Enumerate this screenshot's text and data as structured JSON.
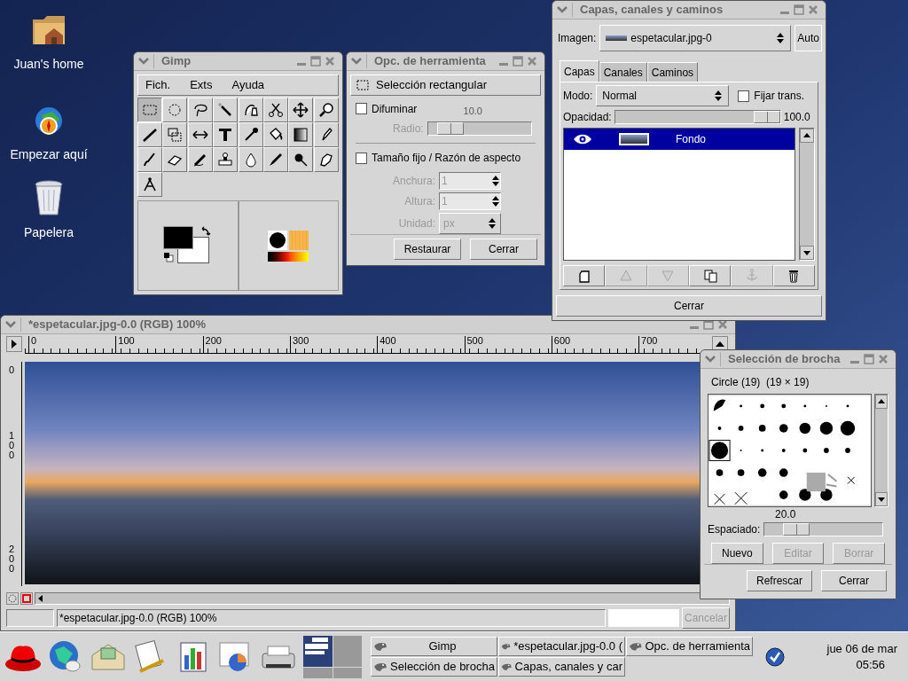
{
  "desktop_icons": [
    {
      "label": "Juan's home"
    },
    {
      "label": "Empezar aquí"
    },
    {
      "label": "Papelera"
    }
  ],
  "toolbox": {
    "title": "Gimp",
    "menu": [
      "Fich.",
      "Exts",
      "Ayuda"
    ],
    "tools": [
      {
        "selected": true
      },
      {
        "selected": false
      },
      {
        "selected": false
      },
      {
        "selected": false
      },
      {
        "selected": false
      },
      {
        "selected": false
      },
      {
        "selected": false
      },
      {
        "selected": false
      },
      {
        "selected": false
      },
      {
        "selected": false
      },
      {
        "selected": false
      },
      {
        "selected": false
      },
      {
        "selected": false
      },
      {
        "selected": false
      },
      {
        "selected": false
      },
      {
        "selected": false
      },
      {
        "selected": false
      },
      {
        "selected": false
      },
      {
        "selected": false
      },
      {
        "selected": false
      },
      {
        "selected": false
      },
      {
        "selected": false
      },
      {
        "selected": false
      },
      {
        "selected": false
      },
      {
        "selected": false
      }
    ]
  },
  "tool_options": {
    "title": "Opc. de herramienta",
    "tool_name": "Selección rectangular",
    "feather": {
      "label": "Difuminar",
      "checked": false
    },
    "radius": {
      "label": "Radio:",
      "value": "10.0",
      "level": 0.12,
      "disabled": true
    },
    "fixed_size": {
      "label": "Tamaño fijo / Razón de aspecto",
      "checked": false
    },
    "fields": [
      {
        "label": "Anchura:",
        "value": "1",
        "disabled": true
      },
      {
        "label": "Altura:",
        "value": "1",
        "disabled": true
      }
    ],
    "unit": {
      "label": "Unidad:",
      "value": "px",
      "disabled": true
    },
    "buttons": [
      "Restaurar",
      "Cerrar"
    ]
  },
  "layers_dialog": {
    "title": "Capas, canales y caminos",
    "image_label": "Imagen:",
    "image_value": "espetacular.jpg-0",
    "auto_button": "Auto",
    "tabs": [
      {
        "label": "Capas",
        "selected": true
      },
      {
        "label": "Canales",
        "selected": false
      },
      {
        "label": "Caminos",
        "selected": false
      }
    ],
    "mode_label": "Modo:",
    "mode_value": "Normal",
    "keep_trans": {
      "label": "Fijar trans.",
      "checked": false
    },
    "opacity": {
      "label": "Opacidad:",
      "level": 1.0,
      "reading": "100.0"
    },
    "layers": [
      {
        "name": "Fondo",
        "selected": true,
        "visible": true
      }
    ],
    "layer_buttons": [
      {
        "disabled": false
      },
      {
        "disabled": true
      },
      {
        "disabled": true
      },
      {
        "disabled": false
      },
      {
        "disabled": true
      },
      {
        "disabled": false
      }
    ],
    "close_button": "Cerrar"
  },
  "image_window": {
    "title": "*espetacular.jpg-0.0 (RGB) 100%",
    "ruler_labels": [
      "0",
      "100",
      "200",
      "300",
      "400",
      "500",
      "600",
      "700"
    ],
    "vertical_ruler_labels": [
      "0",
      "100",
      "200"
    ],
    "status": "*espetacular.jpg-0.0 (RGB) 100%",
    "progress": {
      "level": 0
    },
    "cancel_button": {
      "label": "Cancelar",
      "disabled": true
    }
  },
  "brush_dialog": {
    "title": "Selección de brocha",
    "brush_name": "Circle (19)  (19 × 19)",
    "spacing": {
      "label": "Espaciado:",
      "value": "20.0",
      "level": 0.2
    },
    "buttons": [
      {
        "label": "Nuevo",
        "disabled": false
      },
      {
        "label": "Editar",
        "disabled": true
      },
      {
        "label": "Borrar",
        "disabled": true
      }
    ],
    "bottom_buttons": [
      "Refrescar",
      "Cerrar"
    ]
  },
  "taskbar": {
    "tasks": [
      {
        "label": "Gimp"
      },
      {
        "label": "*espetacular.jpg-0.0 ("
      },
      {
        "label": "Opc. de herramienta"
      },
      {
        "label": "Selección de brocha"
      },
      {
        "label": "Capas, canales y car"
      }
    ],
    "clock_date": "jue 06 de mar",
    "clock_time": "05:56"
  }
}
